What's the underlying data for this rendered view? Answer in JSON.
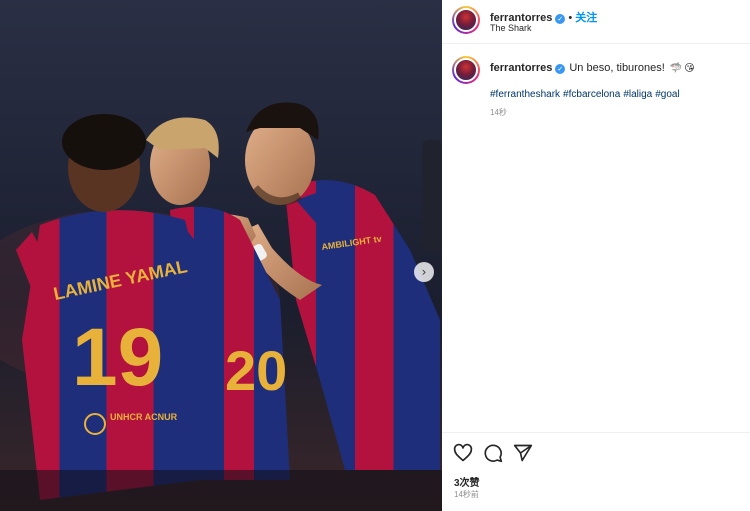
{
  "post": {
    "username": "ferrantorres",
    "follow_label": "关注",
    "separator": "•",
    "location": "The Shark",
    "verified_glyph": "✓",
    "caption": "Un beso, tiburones!",
    "caption_emojis": [
      "shark-emoji",
      "kiss-face-emoji"
    ],
    "emoji_glyphs": [
      "🦈",
      "😘"
    ],
    "hashtags": [
      "#ferrantheshark",
      "#fcbarcelona",
      "#laliga",
      "#goal"
    ],
    "comment_time": "14秒",
    "likes": "3次赞",
    "post_time": "14秒前"
  },
  "photo": {
    "jersey_back_name": "LAMINE YAMAL",
    "jersey_number_left": "19",
    "jersey_number_mid": "20",
    "sponsor": "UNHCR ACNUR",
    "sleeve_text": "AMBILIGHT tv",
    "next_arrow": "›"
  },
  "colors": {
    "blaugrana_blue": "#1f2e7a",
    "blaugrana_red": "#b3123f",
    "gold": "#e8b23a",
    "link_blue": "#00376b",
    "follow_blue": "#0095f6"
  }
}
